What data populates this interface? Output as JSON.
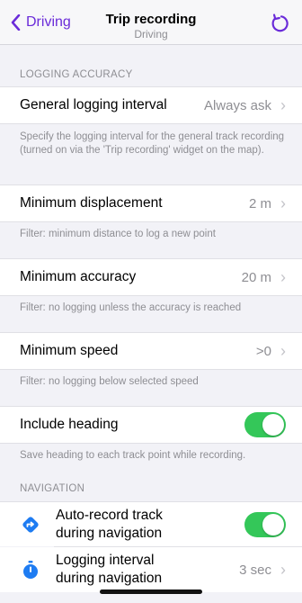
{
  "nav": {
    "back_label": "Driving",
    "title": "Trip recording",
    "subtitle": "Driving",
    "accent": "#6a2bd9"
  },
  "sections": {
    "logging_accuracy": "LOGGING ACCURACY",
    "navigation": "NAVIGATION"
  },
  "general_interval": {
    "label": "General logging interval",
    "value": "Always ask",
    "description": "Specify the logging interval for the general track recording (turned on via the 'Trip recording' widget on the map)."
  },
  "min_displacement": {
    "label": "Minimum displacement",
    "value": "2 m",
    "description": "Filter: minimum distance to log a new point"
  },
  "min_accuracy": {
    "label": "Minimum accuracy",
    "value": "20 m",
    "description": "Filter: no logging unless the accuracy is reached"
  },
  "min_speed": {
    "label": "Minimum speed",
    "value": ">0",
    "description": "Filter: no logging below selected speed"
  },
  "include_heading": {
    "label": "Include heading",
    "enabled": true,
    "description": "Save heading to each track point while recording."
  },
  "auto_record": {
    "label_line1": "Auto-record track",
    "label_line2": "during navigation",
    "enabled": true,
    "icon": "route-diamond-icon"
  },
  "nav_interval": {
    "label_line1": "Logging interval",
    "label_line2": "during navigation",
    "value": "3 sec",
    "icon": "stopwatch-icon"
  },
  "colors": {
    "toggle_on": "#34c759",
    "icon_blue": "#1e7cf2"
  }
}
